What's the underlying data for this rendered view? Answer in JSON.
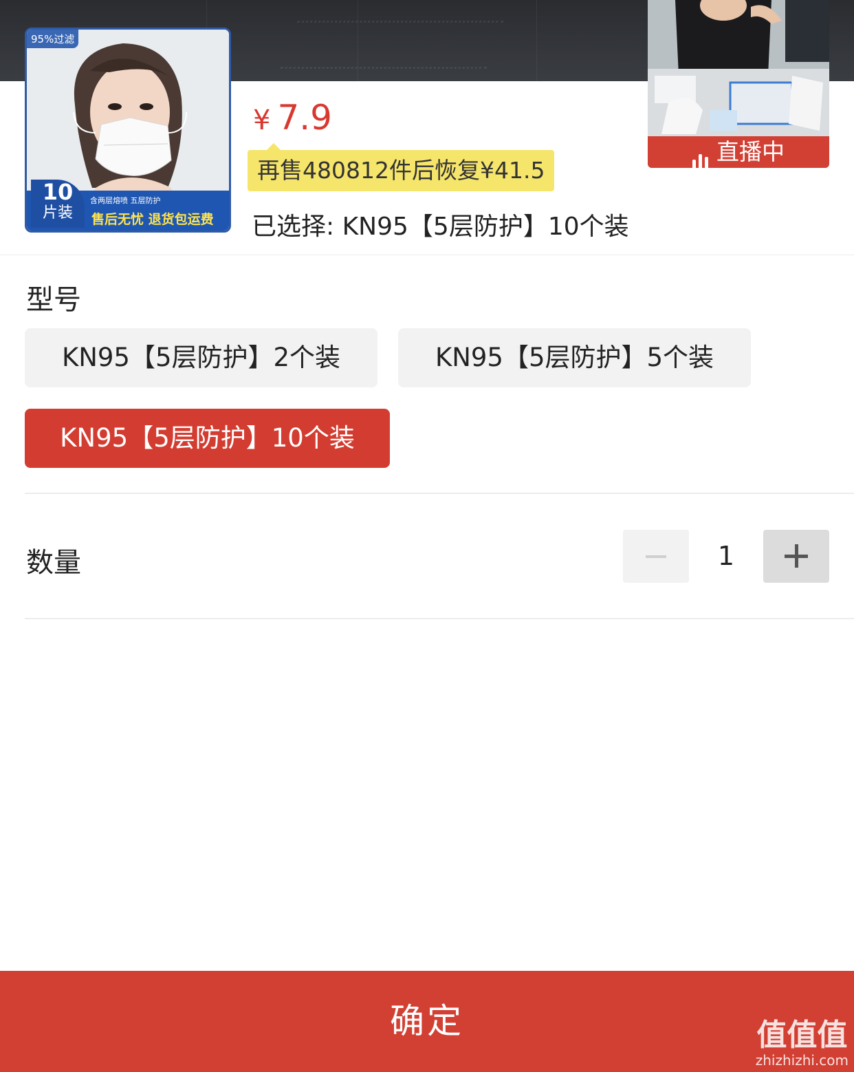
{
  "product": {
    "badge": "95%过滤",
    "band_top": "含两层熔喷 五层防护",
    "band_bottom": "售后无忧 退货包运费",
    "count_number": "10",
    "count_unit": "片装"
  },
  "price": {
    "currency": "¥",
    "amount": "7.9",
    "color": "#d8382f"
  },
  "promo": {
    "text": "再售480812件后恢复¥41.5"
  },
  "selected_text": "已选择: KN95【5层防护】10个装",
  "live": {
    "label": "直播中",
    "icon": "live-bars-icon"
  },
  "spec": {
    "title": "型号",
    "options": [
      {
        "label": "KN95【5层防护】2个装",
        "selected": false
      },
      {
        "label": "KN95【5层防护】5个装",
        "selected": false
      },
      {
        "label": "KN95【5层防护】10个装",
        "selected": true
      }
    ]
  },
  "quantity": {
    "label": "数量",
    "value": "1",
    "minus_icon": "minus-icon",
    "plus_icon": "plus-icon"
  },
  "confirm_label": "确定",
  "watermark": {
    "main": "值值值",
    "sub": "zhizhizhi.com"
  },
  "colors": {
    "accent": "#d23f33",
    "promo_bg": "#f6e56b",
    "option_bg": "#f2f2f2"
  }
}
